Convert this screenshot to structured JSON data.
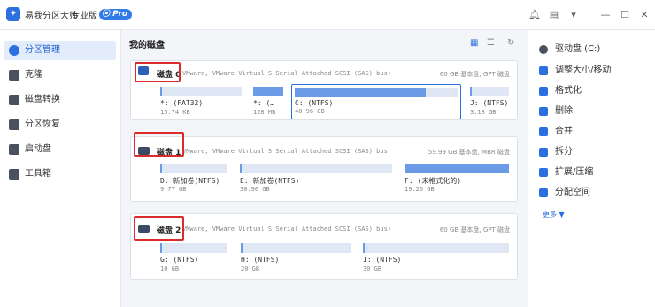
{
  "app": {
    "title": "易我分区大师",
    "edition": "专业版",
    "badge": "Pro"
  },
  "titlebar_icons": [
    "bell-icon",
    "note-icon",
    "dropdown-icon",
    "minimize-icon",
    "maximize-icon",
    "close-icon"
  ],
  "sidebar": {
    "items": [
      {
        "label": "分区管理",
        "active": true
      },
      {
        "label": "克隆",
        "active": false
      },
      {
        "label": "磁盘转换",
        "active": false
      },
      {
        "label": "分区恢复",
        "active": false
      },
      {
        "label": "启动盘",
        "active": false
      },
      {
        "label": "工具箱",
        "active": false
      }
    ]
  },
  "main": {
    "title": "我的磁盘",
    "disks": [
      {
        "name": "磁盘 0",
        "desc": "VMware, VMware Virtual S Serial Attached SCSI (SAS) bus)",
        "meta": "60 GB 基本盘, GPT 磁盘",
        "partitions": [
          {
            "name": "*: (FAT32)",
            "size": "15.74 KB",
            "used": 0.0
          },
          {
            "name": "*: (…",
            "size": "128 MB",
            "used": 1.0
          },
          {
            "name": "C: (NTFS)",
            "size": "40.96 GB",
            "used": 0.8
          },
          {
            "name": "J: (NTFS)",
            "size": "3.18 GB",
            "used": 0.0
          }
        ]
      },
      {
        "name": "磁盘 1",
        "desc": "VMware, VMware Virtual S Serial Attached SCSI (SAS) bus",
        "meta": "59.99 GB 基本盘, MBR 磁盘",
        "partitions": [
          {
            "name": "D: 新加卷(NTFS)",
            "size": "9.77 GB",
            "used": 0.0
          },
          {
            "name": "E: 新加卷(NTFS)",
            "size": "30.96 GB",
            "used": 0.0
          },
          {
            "name": "F: (未格式化的)",
            "size": "19.26 GB",
            "used": 1.0
          }
        ]
      },
      {
        "name": "磁盘 2",
        "desc": "VMware, VMware Virtual S Serial Attached SCSI (SAS) bus)",
        "meta": "60 GB 基本盘, GPT 磁盘",
        "partitions": [
          {
            "name": "G: (NTFS)",
            "size": "10 GB",
            "used": 0.0
          },
          {
            "name": "H: (NTFS)",
            "size": "20 GB",
            "used": 0.0
          },
          {
            "name": "I: (NTFS)",
            "size": "30 GB",
            "used": 0.0
          }
        ]
      }
    ]
  },
  "rightpanel": {
    "selected": "驱动盘 (C:)",
    "actions": [
      "调整大小/移动",
      "格式化",
      "删除",
      "合并",
      "拆分",
      "扩展/压缩",
      "分配空间"
    ],
    "more": "更多 ▼"
  },
  "colors": {
    "accent": "#2b6fe0",
    "highlight": "#d92b2b",
    "partition_bar": "#dfe6f4",
    "partition_fill": "#6b9be6"
  }
}
